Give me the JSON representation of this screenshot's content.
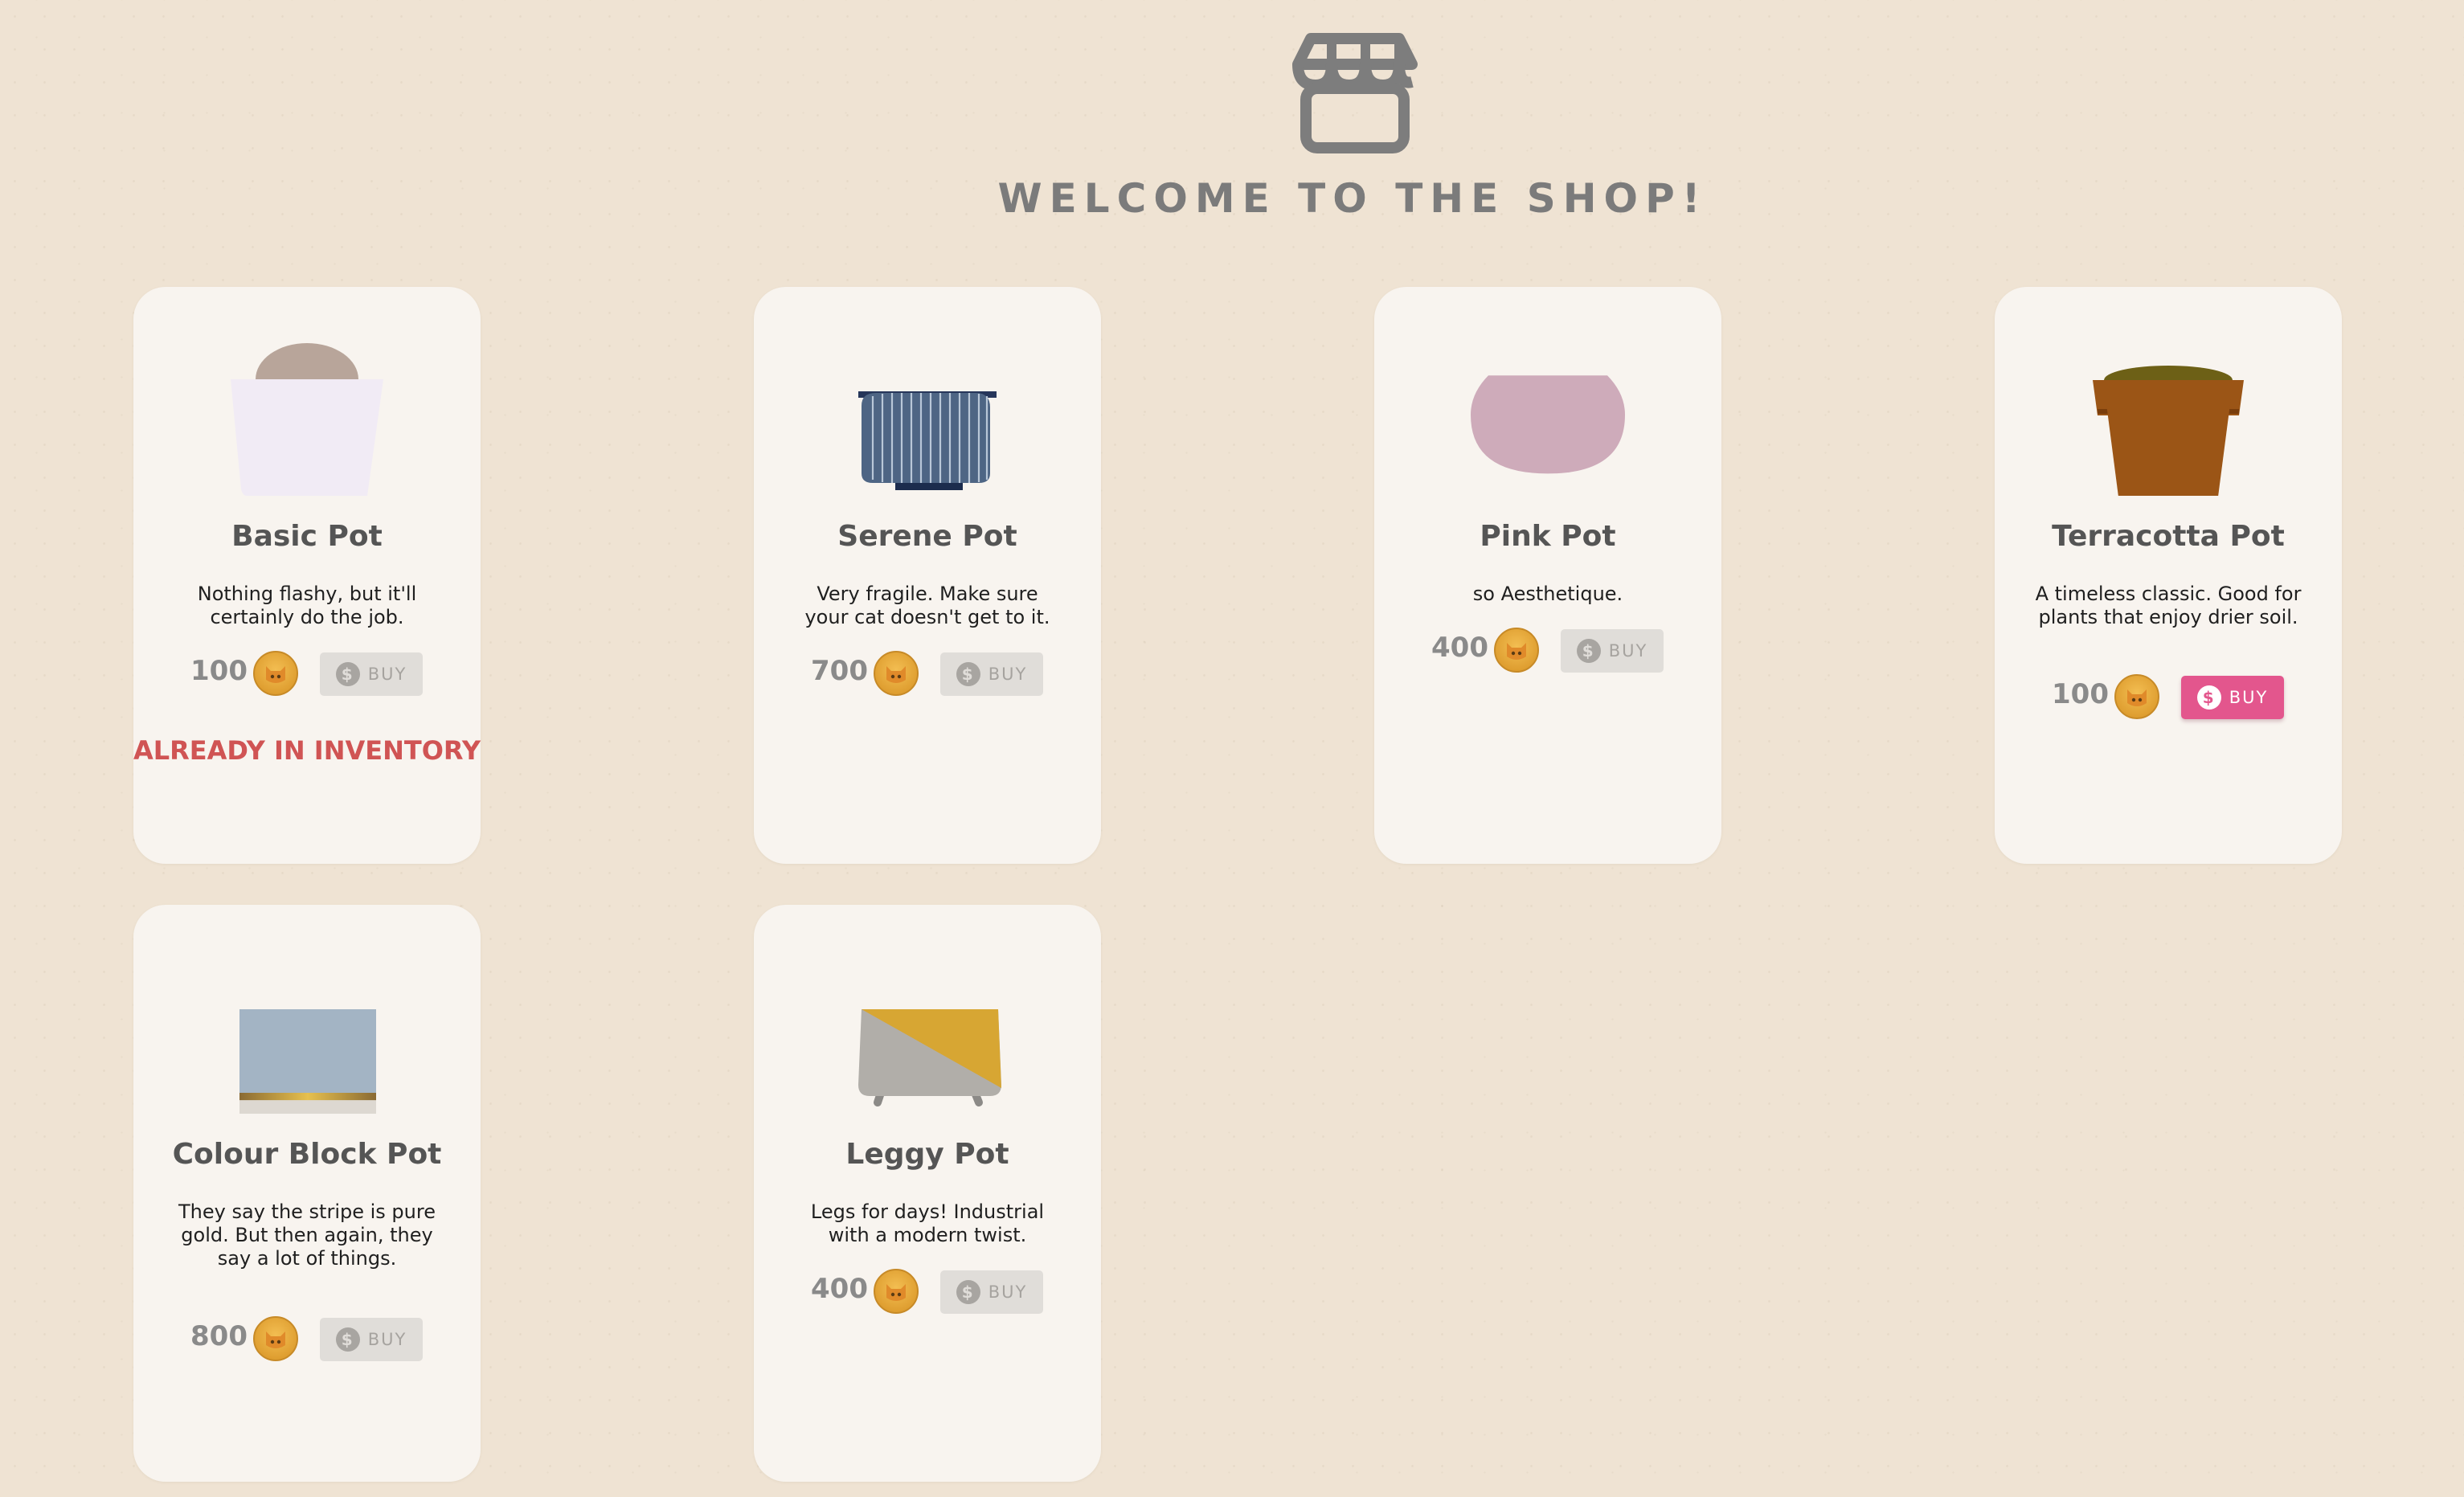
{
  "header": {
    "icon": "storefront-icon",
    "title": "WELCOME TO THE SHOP!"
  },
  "currency_icon": "cat-coin-icon",
  "buy_icon": "dollar-icon",
  "colors": {
    "background": "#efe3d3",
    "card": "#f8f4ef",
    "buy_active": "#e3568d",
    "buy_disabled": "#e0ddd9",
    "owned_text": "#d05454",
    "coin": "#e9a93a"
  },
  "pots": [
    {
      "name": "Basic Pot",
      "description": "Nothing flashy, but it'll certainly do the job.",
      "price": "100",
      "buy_label": "BUY",
      "buy_enabled": false,
      "status": "ALREADY IN INVENTORY",
      "image": "basic-pot"
    },
    {
      "name": "Serene Pot",
      "description": "Very fragile. Make sure your cat doesn't get to it.",
      "price": "700",
      "buy_label": "BUY",
      "buy_enabled": false,
      "image": "serene-pot"
    },
    {
      "name": "Pink Pot",
      "description": "so Aesthetique.",
      "price": "400",
      "buy_label": "BUY",
      "buy_enabled": false,
      "image": "pink-pot"
    },
    {
      "name": "Terracotta Pot",
      "description": "A timeless classic. Good for plants that enjoy drier soil.",
      "price": "100",
      "buy_label": "BUY",
      "buy_enabled": true,
      "image": "terracotta-pot"
    },
    {
      "name": "Colour Block Pot",
      "description": "They say the stripe is pure gold. But then again, they say a lot of things.",
      "price": "800",
      "buy_label": "BUY",
      "buy_enabled": false,
      "image": "colour-block-pot"
    },
    {
      "name": "Leggy Pot",
      "description": "Legs for days! Industrial with a modern twist.",
      "price": "400",
      "buy_label": "BUY",
      "buy_enabled": false,
      "image": "leggy-pot"
    }
  ]
}
